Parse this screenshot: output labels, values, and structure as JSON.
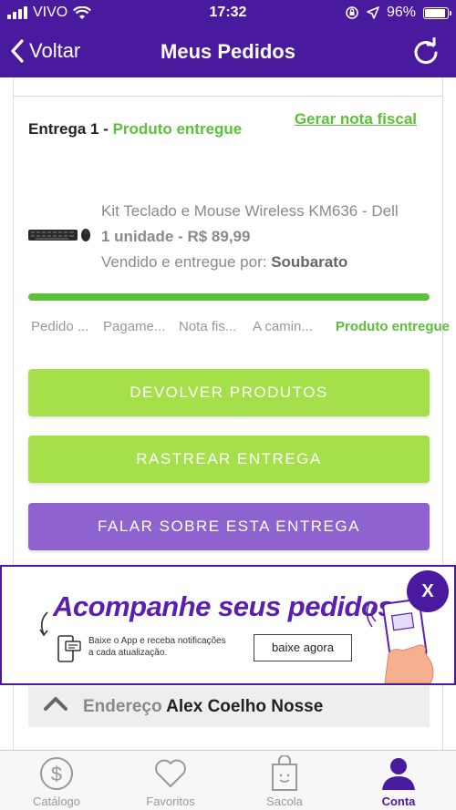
{
  "status_bar": {
    "carrier": "VIVO",
    "time": "17:32",
    "battery": "96%"
  },
  "nav": {
    "back_label": "Voltar",
    "title": "Meus Pedidos"
  },
  "delivery": {
    "title_prefix": "Entrega 1 - ",
    "status": "Produto entregue",
    "invoice_link": "Gerar nota fiscal"
  },
  "product": {
    "name": "Kit Teclado e Mouse Wireless KM636 - Dell",
    "quantity_price": "1 unidade - R$ 89,99",
    "seller_prefix": "Vendido e entregue por: ",
    "seller": "Soubarato"
  },
  "progress_steps": [
    "Pedido ...",
    "Pagame...",
    "Nota fis...",
    "A camin...",
    "Produto entregue"
  ],
  "buttons": {
    "return": "DEVOLVER PRODUTOS",
    "track": "RASTREAR ENTREGA",
    "talk": "FALAR SOBRE ESTA ENTREGA"
  },
  "banner": {
    "headline": "Acompanhe seus pedidos",
    "subtext_line1": "Baixe o App e receba notificações",
    "subtext_line2": "a cada atualização.",
    "cta": "baixe agora",
    "close": "X"
  },
  "address": {
    "label": "Endereço",
    "name": "Alex Coelho Nosse"
  },
  "tabs": [
    {
      "label": "Catálogo",
      "icon": "dollar-circle-icon"
    },
    {
      "label": "Favoritos",
      "icon": "heart-icon"
    },
    {
      "label": "Sacola",
      "icon": "bag-icon"
    },
    {
      "label": "Conta",
      "icon": "user-icon",
      "active": true
    }
  ],
  "colors": {
    "brand_purple": "#4a1a9e",
    "green": "#5cc13a",
    "button_green": "#a5e04a",
    "button_purple": "#8f63cf"
  }
}
